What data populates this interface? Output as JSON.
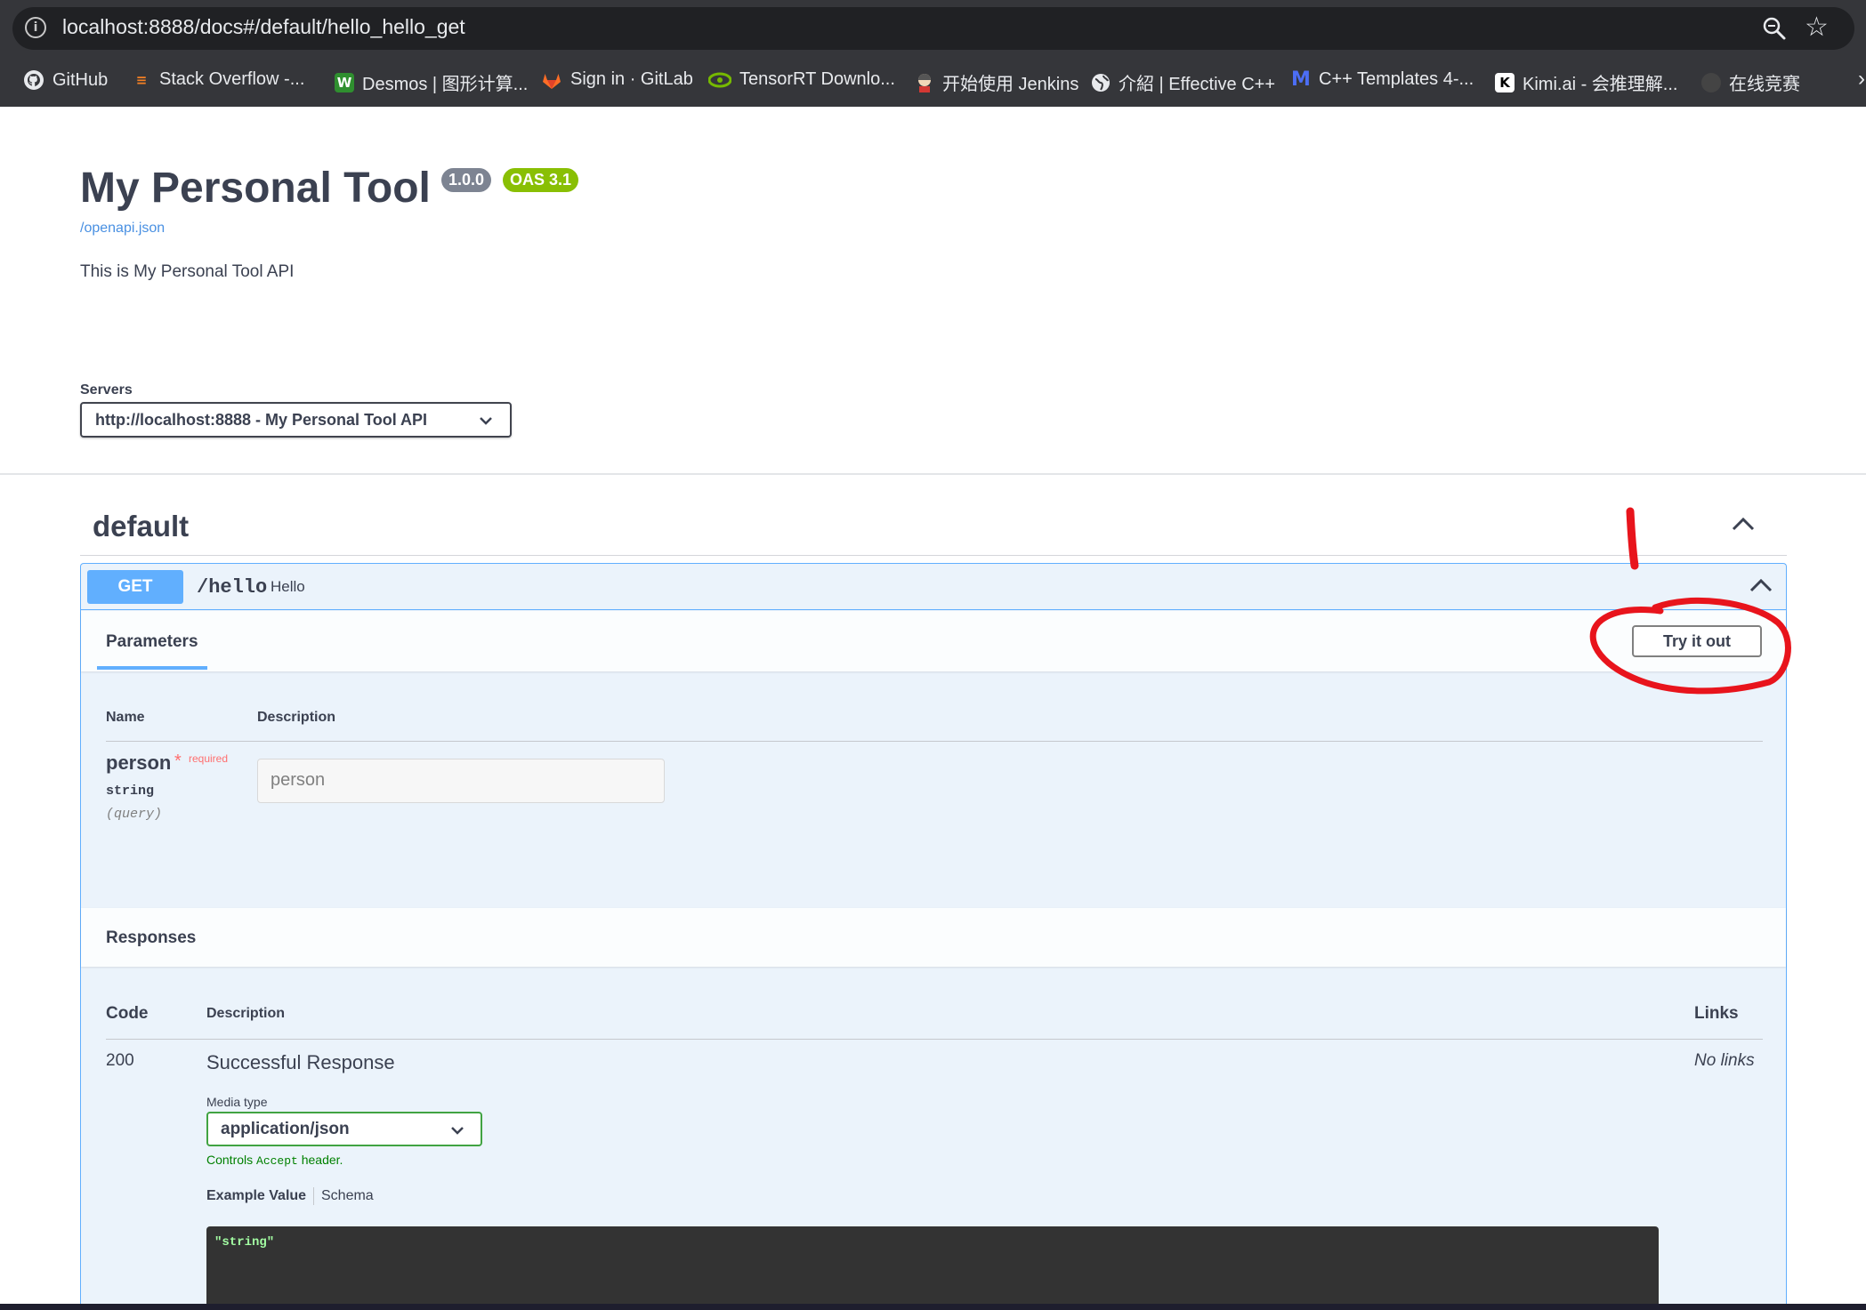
{
  "browser": {
    "url": "localhost:8888/docs#/default/hello_hello_get",
    "bookmarks": [
      {
        "label": "GitHub",
        "icon": "github-icon",
        "color": "#e8eaed"
      },
      {
        "label": "Stack Overflow -...",
        "icon": "stackoverflow-icon",
        "color": "#f48024"
      },
      {
        "label": "Desmos | 图形计算...",
        "icon": "desmos-icon",
        "color": "#2f8f2f"
      },
      {
        "label": "Sign in · GitLab",
        "icon": "gitlab-icon",
        "color": "#fc6d26"
      },
      {
        "label": "TensorRT Downlo...",
        "icon": "nvidia-icon",
        "color": "#76b900"
      },
      {
        "label": "开始使用 Jenkins",
        "icon": "jenkins-icon",
        "color": "#d33833"
      },
      {
        "label": "介紹 | Effective C++",
        "icon": "globe-icon",
        "color": "#e8eaed"
      },
      {
        "label": "C++ Templates 4-...",
        "icon": "m-icon",
        "color": "#4c6ef5"
      },
      {
        "label": "Kimi.ai - 会推理解...",
        "icon": "kimi-icon",
        "color": "#ffffff"
      },
      {
        "label": "在线竞赛",
        "icon": "contest-icon",
        "color": "#444444"
      }
    ]
  },
  "info": {
    "title": "My Personal Tool",
    "version": "1.0.0",
    "oas": "OAS 3.1",
    "spec_link": "/openapi.json",
    "description": "This is My Personal Tool API"
  },
  "servers": {
    "label": "Servers",
    "selected": "http://localhost:8888 - My Personal Tool API"
  },
  "tag": {
    "name": "default"
  },
  "operation": {
    "method": "GET",
    "path": "/hello",
    "summary": "Hello",
    "parameters_tab": "Parameters",
    "try_it_out": "Try it out",
    "param_headers": {
      "name": "Name",
      "description": "Description"
    },
    "parameter": {
      "name": "person",
      "required_mark": "*",
      "required_label": "required",
      "type": "string",
      "in": "(query)",
      "placeholder": "person"
    },
    "responses": {
      "title": "Responses",
      "headers": {
        "code": "Code",
        "description": "Description",
        "links": "Links"
      },
      "rows": [
        {
          "code": "200",
          "description": "Successful Response",
          "links": "No links",
          "media_type_label": "Media type",
          "media_type": "application/json",
          "controls_prefix": "Controls",
          "controls_code": "Accept",
          "controls_suffix": "header.",
          "example_tab": "Example Value",
          "schema_tab": "Schema",
          "example": "\"string\""
        }
      ]
    }
  },
  "colors": {
    "get": "#61affe",
    "oas_badge": "#89bf04",
    "version_badge": "#7d8492",
    "annotation": "#e8141c"
  }
}
